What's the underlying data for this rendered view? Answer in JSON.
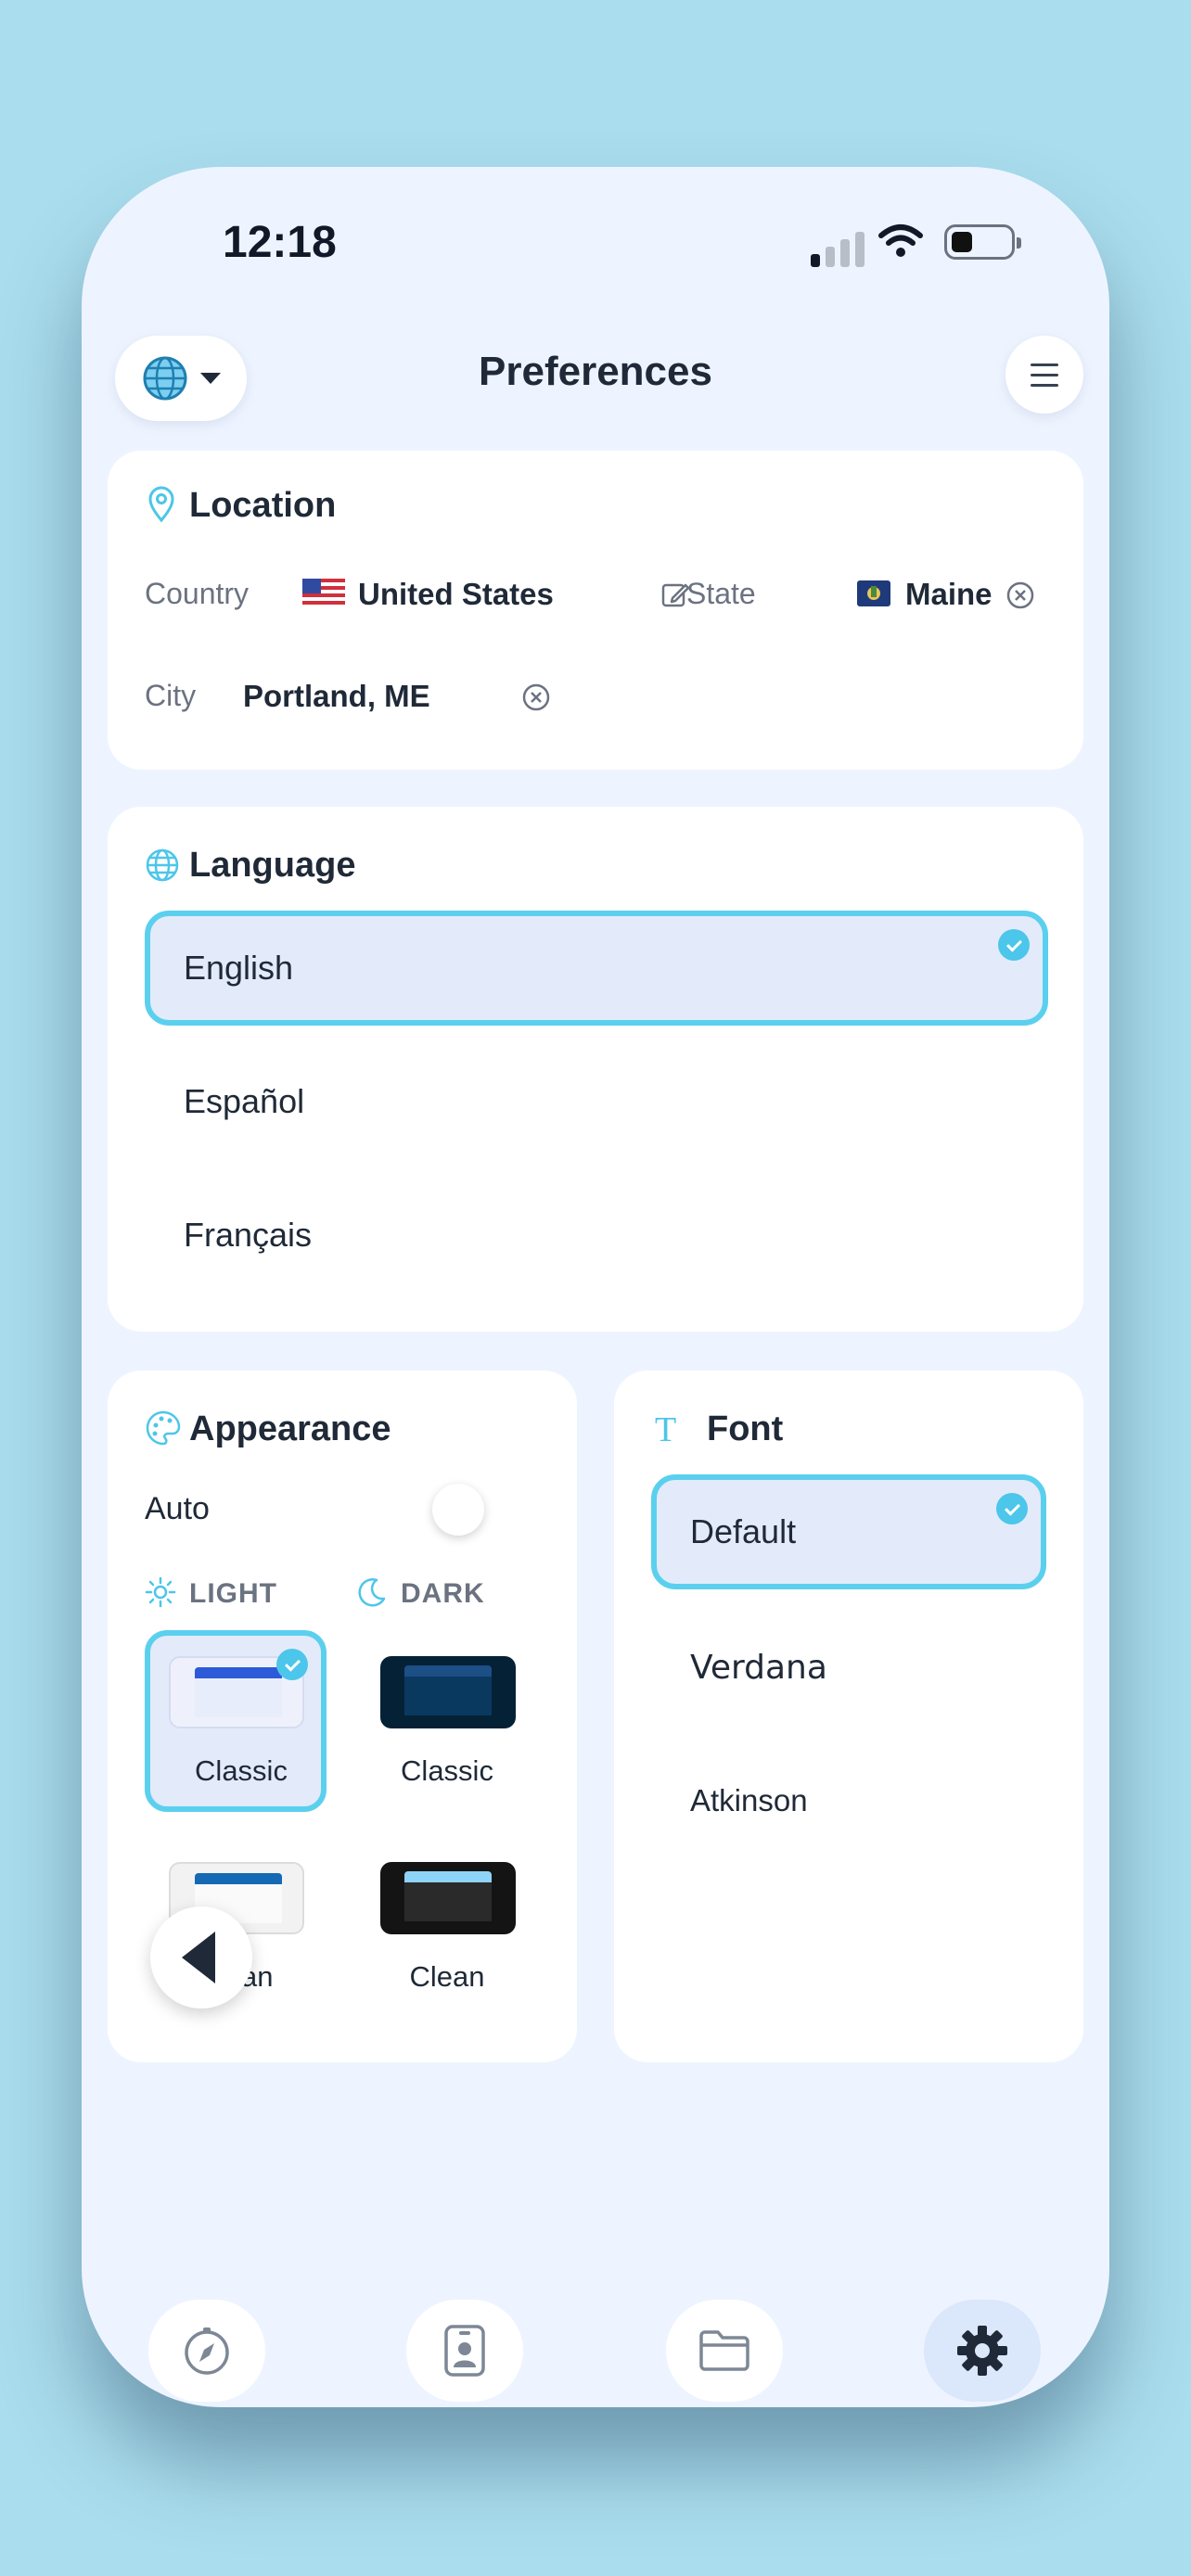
{
  "status": {
    "time": "12:18"
  },
  "header": {
    "title": "Preferences"
  },
  "location": {
    "title": "Location",
    "country_label": "Country",
    "country_value": "United States",
    "state_label": "State",
    "state_value": "Maine",
    "city_label": "City",
    "city_value": "Portland, ME"
  },
  "language": {
    "title": "Language",
    "options": [
      "English",
      "Español",
      "Français"
    ],
    "selected": "English"
  },
  "appearance": {
    "title": "Appearance",
    "auto_label": "Auto",
    "auto_on": false,
    "light_label": "LIGHT",
    "dark_label": "DARK",
    "themes": [
      {
        "label": "Classic",
        "mode": "light",
        "selected": true
      },
      {
        "label": "Classic",
        "mode": "dark",
        "selected": false
      },
      {
        "label": "Clean",
        "mode": "light",
        "selected": false
      },
      {
        "label": "Clean",
        "mode": "dark",
        "selected": false
      }
    ]
  },
  "font": {
    "title": "Font",
    "options": [
      "Default",
      "Verdana",
      "Atkinson"
    ],
    "selected": "Default"
  },
  "colors": {
    "accent": "#5bd0ee",
    "selected_bg": "#e3ebfb",
    "background": "#aadeee",
    "screen": "#eef4ff"
  },
  "nav": {
    "items": [
      "compass-icon",
      "contact-card-icon",
      "folder-icon",
      "gear-icon"
    ],
    "active": "gear-icon"
  }
}
